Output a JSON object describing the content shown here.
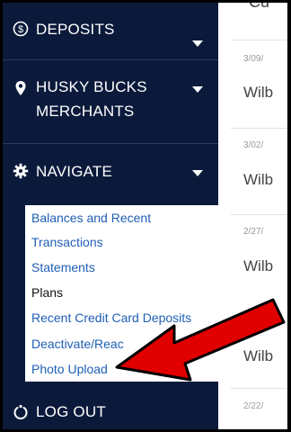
{
  "sidebar": {
    "deposits_label": "DEPOSITS",
    "husky_label": "HUSKY BUCKS MERCHANTS",
    "navigate_label": "NAVIGATE",
    "logout_label": "LOG OUT",
    "submenu": [
      "Balances and Recent",
      "Transactions",
      "Statements",
      "Plans",
      "Recent Credit Card Deposits",
      "Deactivate/Reac",
      "Photo Upload"
    ]
  },
  "content": {
    "top_fragment": "Cu",
    "rows": [
      {
        "date": "3/09/",
        "merchant": "Wilb"
      },
      {
        "date": "3/02/",
        "merchant": "Wilb"
      },
      {
        "date": "2/27/",
        "merchant": "Wilb"
      },
      {
        "date": "",
        "merchant": "Wilb"
      },
      {
        "date": "2/22/",
        "merchant": ""
      }
    ]
  },
  "colors": {
    "sidebar_bg": "#0b1a3b",
    "link": "#1f5fb5",
    "arrow": "#e10000"
  },
  "icons": [
    "dollar-circle-icon",
    "map-pin-icon",
    "gear-icon",
    "chevron-down-icon",
    "logout-icon"
  ]
}
